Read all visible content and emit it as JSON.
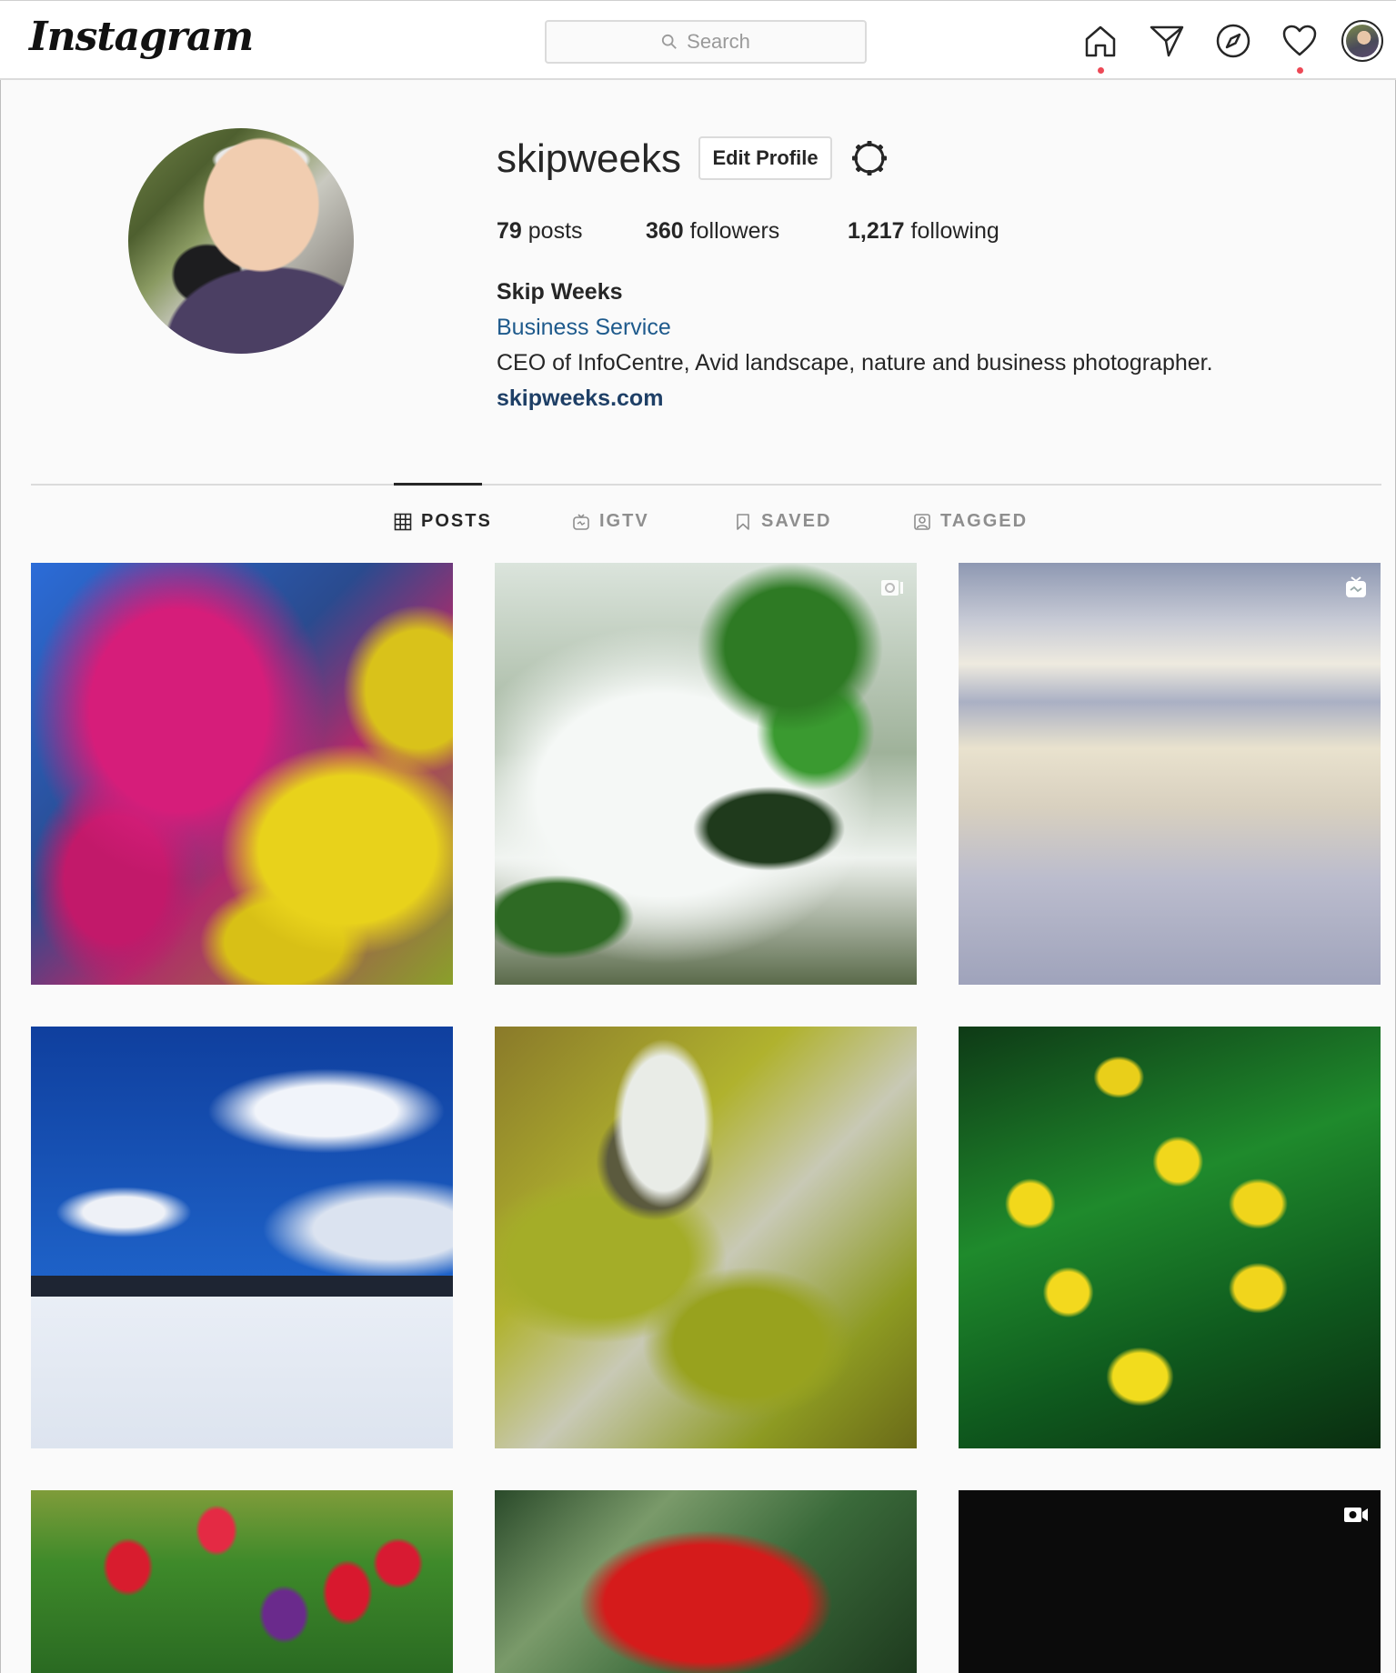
{
  "header": {
    "logo_text": "Instagram",
    "search_placeholder": "Search"
  },
  "nav": {
    "icons": [
      "home-icon",
      "direct-icon",
      "explore-icon",
      "activity-icon",
      "profile-avatar"
    ],
    "notification_color": "#ed4956"
  },
  "profile": {
    "username": "skipweeks",
    "edit_label": "Edit Profile",
    "posts_count": "79",
    "posts_label": " posts",
    "followers_count": "360",
    "followers_label": " followers",
    "following_count": "1,217",
    "following_label": " following",
    "full_name": "Skip Weeks",
    "category": "Business Service",
    "bio": "CEO of InfoCentre, Avid landscape, nature and business photographer.",
    "website": "skipweeks.com"
  },
  "tabs": [
    {
      "label": "POSTS",
      "icon": "grid-icon",
      "active": true
    },
    {
      "label": "IGTV",
      "icon": "igtv-icon",
      "active": false
    },
    {
      "label": "SAVED",
      "icon": "bookmark-icon",
      "active": false
    },
    {
      "label": "TAGGED",
      "icon": "tag-icon",
      "active": false
    }
  ],
  "posts": [
    {
      "subject": "pink and yellow blossoms",
      "badge": null
    },
    {
      "subject": "waterfall over mossy rocks",
      "badge": "carousel-icon"
    },
    {
      "subject": "calm water surface",
      "badge": "igtv-icon"
    },
    {
      "subject": "blue sky over snowy lake",
      "badge": null
    },
    {
      "subject": "mossy stream cascade",
      "badge": null
    },
    {
      "subject": "yellow trout lilies",
      "badge": null
    },
    {
      "subject": "red tulips in meadow",
      "badge": null
    },
    {
      "subject": "red flower with water drops",
      "badge": null
    },
    {
      "subject": "dark video",
      "badge": "video-icon"
    }
  ]
}
